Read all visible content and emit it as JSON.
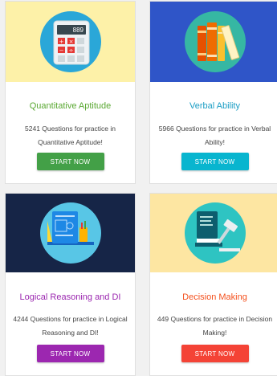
{
  "cards": [
    {
      "title": "Quantitative Aptitude",
      "description": "5241 Questions for practice in Quantitative Aptitude!",
      "button_label": "START NOW",
      "icon": "calculator-icon",
      "title_color": "#5aa832",
      "banner_color": "#fdf1a8",
      "circle_color": "#2aa7d8",
      "button_color": "#43a047",
      "calculator_display": "889"
    },
    {
      "title": "Verbal Ability",
      "description": "5966 Questions for practice in Verbal Ability!",
      "button_label": "START NOW",
      "icon": "books-icon",
      "title_color": "#1a9dc4",
      "banner_color": "#2f55c8",
      "circle_color": "#36b7a3",
      "button_color": "#08b5cf"
    },
    {
      "title": "Logical Reasoning and DI",
      "description": "4244 Questions for practice in Logical Reasoning and DI!",
      "button_label": "START NOW",
      "icon": "blueprint-icon",
      "title_color": "#9b27b0",
      "banner_color": "#162547",
      "circle_color": "#58c6e6",
      "button_color": "#9c27b0"
    },
    {
      "title": "Decision Making",
      "description": "449 Questions for practice in Decision Making!",
      "button_label": "START NOW",
      "icon": "gavel-icon",
      "title_color": "#f4511e",
      "banner_color": "#fde6a2",
      "circle_color": "#2ec4c2",
      "button_color": "#f44336"
    }
  ]
}
